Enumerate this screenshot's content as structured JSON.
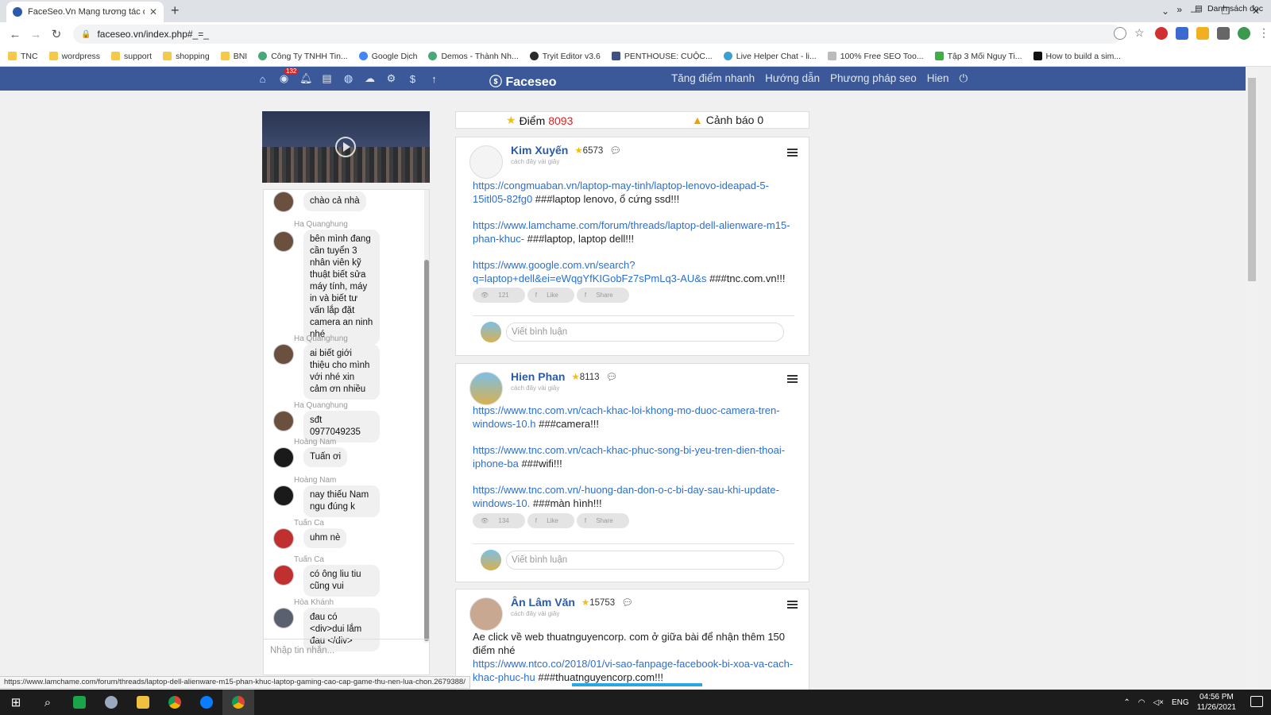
{
  "browser": {
    "tab_title": "FaceSeo.Vn Mạng tương tác dành",
    "url": "faceseo.vn/index.php#_=_",
    "bookmarks": [
      "TNC",
      "wordpress",
      "support",
      "shopping",
      "BNI",
      "Công Ty TNHH Tin...",
      "Google Dịch",
      "Demos - Thành Nh...",
      "Tryit Editor v3.6",
      "PENTHOUSE: CUỘC...",
      "Live Helper Chat - li...",
      "100% Free SEO Too...",
      "Tập 3 Mối Nguy Ti...",
      "How to build a sim..."
    ],
    "bookmarks_more": "»",
    "reading_list": "Danh sách đọc",
    "status_url": "https://www.lamchame.com/forum/threads/laptop-dell-alienware-m15-phan-khuc-laptop-gaming-cao-cap-game-thu-nen-lua-chon.2679388/"
  },
  "sitebar": {
    "badge": "132",
    "brand": "Faceseo",
    "links": [
      "Tăng điểm nhanh",
      "Hướng dẫn",
      "Phương pháp seo",
      "Hien"
    ]
  },
  "score": {
    "label": "Điểm",
    "value": "8093",
    "warning": "Cảnh báo 0"
  },
  "chat": {
    "messages": [
      {
        "sender": "",
        "text": "chào cả nhà"
      },
      {
        "sender": "Ha Quanghung",
        "text": "bên mình đang cần tuyển 3 nhân viên kỹ thuật biết sửa máy tính, máy in và biết tư vấn lắp đặt camera an ninh nhé"
      },
      {
        "sender": "Ha Quanghung",
        "text": "ai biết giới thiệu cho mình với nhé xin cảm ơn nhiều"
      },
      {
        "sender": "Ha Quanghung",
        "text": "sđt 0977049235"
      },
      {
        "sender": "Hoàng Nam",
        "text": "Tuấn ơi"
      },
      {
        "sender": "Hoàng Nam",
        "text": "nay thiếu Nam ngu đúng k"
      },
      {
        "sender": "Tuấn Ca",
        "text": "uhm nè"
      },
      {
        "sender": "Tuấn Ca",
        "text": "có ông liu tiu cũng vui"
      },
      {
        "sender": "Hòa Khánh",
        "text": "đau có <div>dui lắm đau </div>"
      }
    ],
    "input_placeholder": "Nhập tin nhắn..."
  },
  "posts": [
    {
      "author": "Kim Xuyến",
      "score": "6573",
      "time": "cách đây vài giây",
      "entries": [
        {
          "link": "https://congmuaban.vn/laptop-may-tinh/laptop-lenovo-ideapad-5-15itl05-82fg0",
          "tag": " ###laptop lenovo, ổ cứng ssd!!!"
        },
        {
          "link": "https://www.lamchame.com/forum/threads/laptop-dell-alienware-m15-phan-khuc-",
          "tag": " ###laptop, laptop dell!!!"
        },
        {
          "link": "https://www.google.com.vn/search?q=laptop+dell&ei=eWqgYfKIGobFz7sPmLq3-AU&s",
          "tag": " ###tnc.com.vn!!!"
        }
      ],
      "views": "121",
      "like": "Like",
      "share": "Share",
      "comment_placeholder": "Viết bình luận"
    },
    {
      "author": "Hien Phan",
      "score": "8113",
      "time": "cách đây vài giây",
      "entries": [
        {
          "link": "https://www.tnc.com.vn/cach-khac-loi-khong-mo-duoc-camera-tren-windows-10.h",
          "tag": " ###camera!!!"
        },
        {
          "link": "https://www.tnc.com.vn/cach-khac-phuc-song-bi-yeu-tren-dien-thoai-iphone-ba",
          "tag": " ###wifi!!!"
        },
        {
          "link": "https://www.tnc.com.vn/-huong-dan-don-o-c-bi-day-sau-khi-update-windows-10.",
          "tag": " ###màn hình!!!"
        }
      ],
      "views": "134",
      "like": "Like",
      "share": "Share",
      "comment_placeholder": "Viết bình luận"
    },
    {
      "author": "Ân Lâm Văn",
      "score": "15753",
      "time": "cách đây vài giây",
      "text": "Ae click về web thuatnguyencorp. com ở giữa bài để nhận thêm 150 điểm nhé",
      "entries": [
        {
          "link": "https://www.ntco.co/2018/01/vi-sao-fanpage-facebook-bi-xoa-va-cach-khac-phuc-hu",
          "tag": " ###thuatnguyencorp.com!!!"
        }
      ]
    }
  ],
  "taskbar": {
    "lang": "ENG",
    "time": "04:56 PM",
    "date": "11/26/2021"
  },
  "colors": {
    "navbar": "#3b5998",
    "link": "#2b6fd0",
    "username": "#2b5aa8",
    "score_number": "#e02020"
  }
}
